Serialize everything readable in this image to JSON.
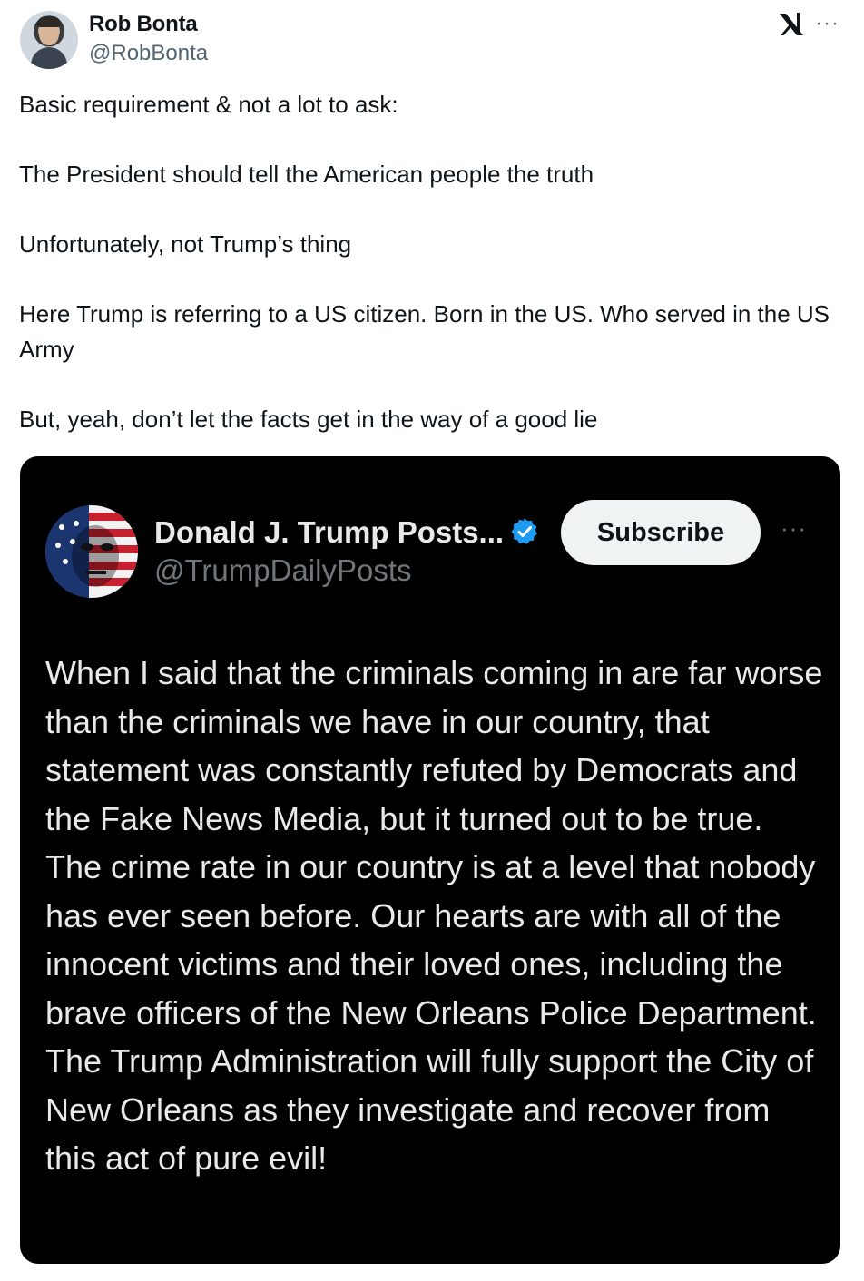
{
  "author": {
    "display_name": "Rob Bonta",
    "handle": "@RobBonta"
  },
  "icons": {
    "top_right": "x-logo-icon",
    "more": "more-icon"
  },
  "more_label": "···",
  "tweet": {
    "paragraphs": [
      "Basic requirement & not a lot to ask:",
      "The President should tell the American people the truth",
      "Unfortunately, not Trump’s thing",
      "Here Trump is referring to a US citizen. Born in the US. Who served in the US Army",
      "But, yeah, don’t let the facts get in the way of a good lie"
    ]
  },
  "embedded_post": {
    "display_name": "Donald J. Trump Posts...",
    "handle": "@TrumpDailyPosts",
    "verified_icon": "verified-badge-icon",
    "subscribe_label": "Subscribe",
    "more_label": "···",
    "text": "When I said that the criminals coming in are far worse than the criminals we have in our country, that statement was constantly refuted by Democrats and the Fake News Media, but it turned out to be true. The crime rate in our country is at a level that nobody has ever seen before. Our hearts are with all of the innocent victims and their loved ones, including the brave officers of the New Orleans Police Department. The Trump Administration will fully support the City of New Orleans as they investigate and recover from this act of pure evil!"
  },
  "colors": {
    "text_primary": "#0f1419",
    "text_secondary": "#536471",
    "embed_background": "#000000",
    "embed_text": "#e7e9ea",
    "embed_secondary": "#71767b",
    "verified_blue": "#1d9bf0",
    "subscribe_bg": "#eff3f4"
  }
}
